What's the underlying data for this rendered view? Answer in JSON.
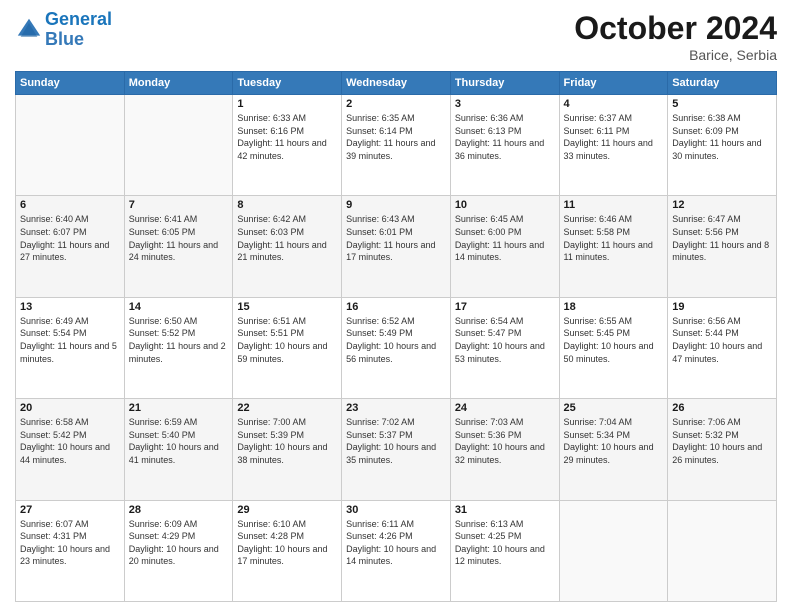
{
  "header": {
    "logo_line1": "General",
    "logo_line2": "Blue",
    "month": "October 2024",
    "location": "Barice, Serbia"
  },
  "days_of_week": [
    "Sunday",
    "Monday",
    "Tuesday",
    "Wednesday",
    "Thursday",
    "Friday",
    "Saturday"
  ],
  "weeks": [
    [
      {
        "day": "",
        "info": ""
      },
      {
        "day": "",
        "info": ""
      },
      {
        "day": "1",
        "info": "Sunrise: 6:33 AM\nSunset: 6:16 PM\nDaylight: 11 hours and 42 minutes."
      },
      {
        "day": "2",
        "info": "Sunrise: 6:35 AM\nSunset: 6:14 PM\nDaylight: 11 hours and 39 minutes."
      },
      {
        "day": "3",
        "info": "Sunrise: 6:36 AM\nSunset: 6:13 PM\nDaylight: 11 hours and 36 minutes."
      },
      {
        "day": "4",
        "info": "Sunrise: 6:37 AM\nSunset: 6:11 PM\nDaylight: 11 hours and 33 minutes."
      },
      {
        "day": "5",
        "info": "Sunrise: 6:38 AM\nSunset: 6:09 PM\nDaylight: 11 hours and 30 minutes."
      }
    ],
    [
      {
        "day": "6",
        "info": "Sunrise: 6:40 AM\nSunset: 6:07 PM\nDaylight: 11 hours and 27 minutes."
      },
      {
        "day": "7",
        "info": "Sunrise: 6:41 AM\nSunset: 6:05 PM\nDaylight: 11 hours and 24 minutes."
      },
      {
        "day": "8",
        "info": "Sunrise: 6:42 AM\nSunset: 6:03 PM\nDaylight: 11 hours and 21 minutes."
      },
      {
        "day": "9",
        "info": "Sunrise: 6:43 AM\nSunset: 6:01 PM\nDaylight: 11 hours and 17 minutes."
      },
      {
        "day": "10",
        "info": "Sunrise: 6:45 AM\nSunset: 6:00 PM\nDaylight: 11 hours and 14 minutes."
      },
      {
        "day": "11",
        "info": "Sunrise: 6:46 AM\nSunset: 5:58 PM\nDaylight: 11 hours and 11 minutes."
      },
      {
        "day": "12",
        "info": "Sunrise: 6:47 AM\nSunset: 5:56 PM\nDaylight: 11 hours and 8 minutes."
      }
    ],
    [
      {
        "day": "13",
        "info": "Sunrise: 6:49 AM\nSunset: 5:54 PM\nDaylight: 11 hours and 5 minutes."
      },
      {
        "day": "14",
        "info": "Sunrise: 6:50 AM\nSunset: 5:52 PM\nDaylight: 11 hours and 2 minutes."
      },
      {
        "day": "15",
        "info": "Sunrise: 6:51 AM\nSunset: 5:51 PM\nDaylight: 10 hours and 59 minutes."
      },
      {
        "day": "16",
        "info": "Sunrise: 6:52 AM\nSunset: 5:49 PM\nDaylight: 10 hours and 56 minutes."
      },
      {
        "day": "17",
        "info": "Sunrise: 6:54 AM\nSunset: 5:47 PM\nDaylight: 10 hours and 53 minutes."
      },
      {
        "day": "18",
        "info": "Sunrise: 6:55 AM\nSunset: 5:45 PM\nDaylight: 10 hours and 50 minutes."
      },
      {
        "day": "19",
        "info": "Sunrise: 6:56 AM\nSunset: 5:44 PM\nDaylight: 10 hours and 47 minutes."
      }
    ],
    [
      {
        "day": "20",
        "info": "Sunrise: 6:58 AM\nSunset: 5:42 PM\nDaylight: 10 hours and 44 minutes."
      },
      {
        "day": "21",
        "info": "Sunrise: 6:59 AM\nSunset: 5:40 PM\nDaylight: 10 hours and 41 minutes."
      },
      {
        "day": "22",
        "info": "Sunrise: 7:00 AM\nSunset: 5:39 PM\nDaylight: 10 hours and 38 minutes."
      },
      {
        "day": "23",
        "info": "Sunrise: 7:02 AM\nSunset: 5:37 PM\nDaylight: 10 hours and 35 minutes."
      },
      {
        "day": "24",
        "info": "Sunrise: 7:03 AM\nSunset: 5:36 PM\nDaylight: 10 hours and 32 minutes."
      },
      {
        "day": "25",
        "info": "Sunrise: 7:04 AM\nSunset: 5:34 PM\nDaylight: 10 hours and 29 minutes."
      },
      {
        "day": "26",
        "info": "Sunrise: 7:06 AM\nSunset: 5:32 PM\nDaylight: 10 hours and 26 minutes."
      }
    ],
    [
      {
        "day": "27",
        "info": "Sunrise: 6:07 AM\nSunset: 4:31 PM\nDaylight: 10 hours and 23 minutes."
      },
      {
        "day": "28",
        "info": "Sunrise: 6:09 AM\nSunset: 4:29 PM\nDaylight: 10 hours and 20 minutes."
      },
      {
        "day": "29",
        "info": "Sunrise: 6:10 AM\nSunset: 4:28 PM\nDaylight: 10 hours and 17 minutes."
      },
      {
        "day": "30",
        "info": "Sunrise: 6:11 AM\nSunset: 4:26 PM\nDaylight: 10 hours and 14 minutes."
      },
      {
        "day": "31",
        "info": "Sunrise: 6:13 AM\nSunset: 4:25 PM\nDaylight: 10 hours and 12 minutes."
      },
      {
        "day": "",
        "info": ""
      },
      {
        "day": "",
        "info": ""
      }
    ]
  ]
}
